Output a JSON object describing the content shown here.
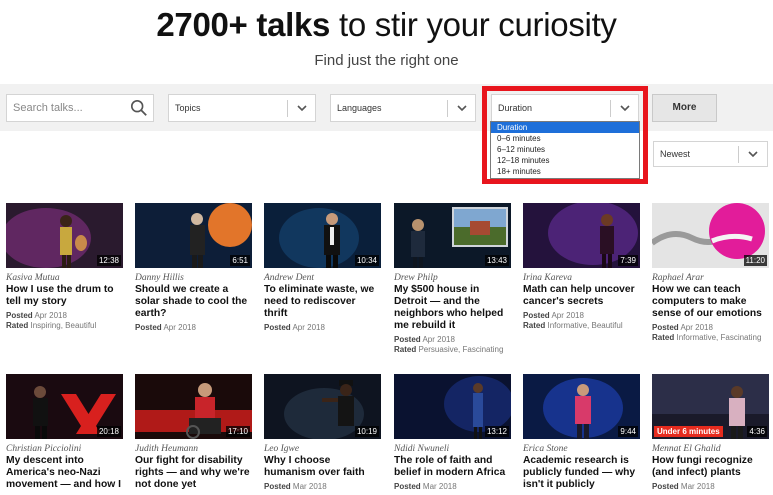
{
  "hero": {
    "count": "2700+ talks",
    "rest": " to stir your curiosity",
    "subtitle": "Find just the right one"
  },
  "filters": {
    "search_placeholder": "Search talks...",
    "topics_label": "Topics",
    "languages_label": "Languages",
    "duration_label": "Duration",
    "duration_options": [
      "Duration",
      "0–6 minutes",
      "6–12 minutes",
      "12–18 minutes",
      "18+ minutes"
    ],
    "duration_selected_index": 0,
    "more_label": "More",
    "sort_label": "Newest"
  },
  "labels": {
    "posted": "Posted",
    "rated": "Rated"
  },
  "talks": [
    {
      "speaker": "Kasiva Mutua",
      "title": "How I use the drum to tell my story",
      "posted": "Apr 2018",
      "rated": "Inspiring, Beautiful",
      "duration": "12:38",
      "badge": ""
    },
    {
      "speaker": "Danny Hillis",
      "title": "Should we create a solar shade to cool the earth?",
      "posted": "Apr 2018",
      "rated": "",
      "duration": "6:51",
      "badge": ""
    },
    {
      "speaker": "Andrew Dent",
      "title": "To eliminate waste, we need to rediscover thrift",
      "posted": "Apr 2018",
      "rated": "",
      "duration": "10:34",
      "badge": ""
    },
    {
      "speaker": "Drew Philp",
      "title": "My $500 house in Detroit — and the neighbors who helped me rebuild it",
      "posted": "Apr 2018",
      "rated": "Persuasive, Fascinating",
      "duration": "13:43",
      "badge": ""
    },
    {
      "speaker": "Irina Kareva",
      "title": "Math can help uncover cancer's secrets",
      "posted": "Apr 2018",
      "rated": "Informative, Beautiful",
      "duration": "7:39",
      "badge": ""
    },
    {
      "speaker": "Raphael Arar",
      "title": "How we can teach computers to make sense of our emotions",
      "posted": "Apr 2018",
      "rated": "Informative, Fascinating",
      "duration": "11:20",
      "badge": ""
    },
    {
      "speaker": "Christian Picciolini",
      "title": "My descent into America's neo-Nazi movement — and how I",
      "posted": "",
      "rated": "",
      "duration": "20:18",
      "badge": ""
    },
    {
      "speaker": "Judith Heumann",
      "title": "Our fight for disability rights — and why we're not done yet",
      "posted": "",
      "rated": "",
      "duration": "17:10",
      "badge": ""
    },
    {
      "speaker": "Leo Igwe",
      "title": "Why I choose humanism over faith",
      "posted": "Mar 2018",
      "rated": "",
      "duration": "10:19",
      "badge": ""
    },
    {
      "speaker": "Ndidi Nwuneli",
      "title": "The role of faith and belief in modern Africa",
      "posted": "Mar 2018",
      "rated": "",
      "duration": "13:12",
      "badge": ""
    },
    {
      "speaker": "Erica Stone",
      "title": "Academic research is publicly funded — why isn't it publicly",
      "posted": "",
      "rated": "",
      "duration": "9:44",
      "badge": ""
    },
    {
      "speaker": "Mennat El Ghalid",
      "title": "How fungi recognize (and infect) plants",
      "posted": "Mar 2018",
      "rated": "",
      "duration": "4:36",
      "badge": "Under 6 minutes"
    }
  ]
}
